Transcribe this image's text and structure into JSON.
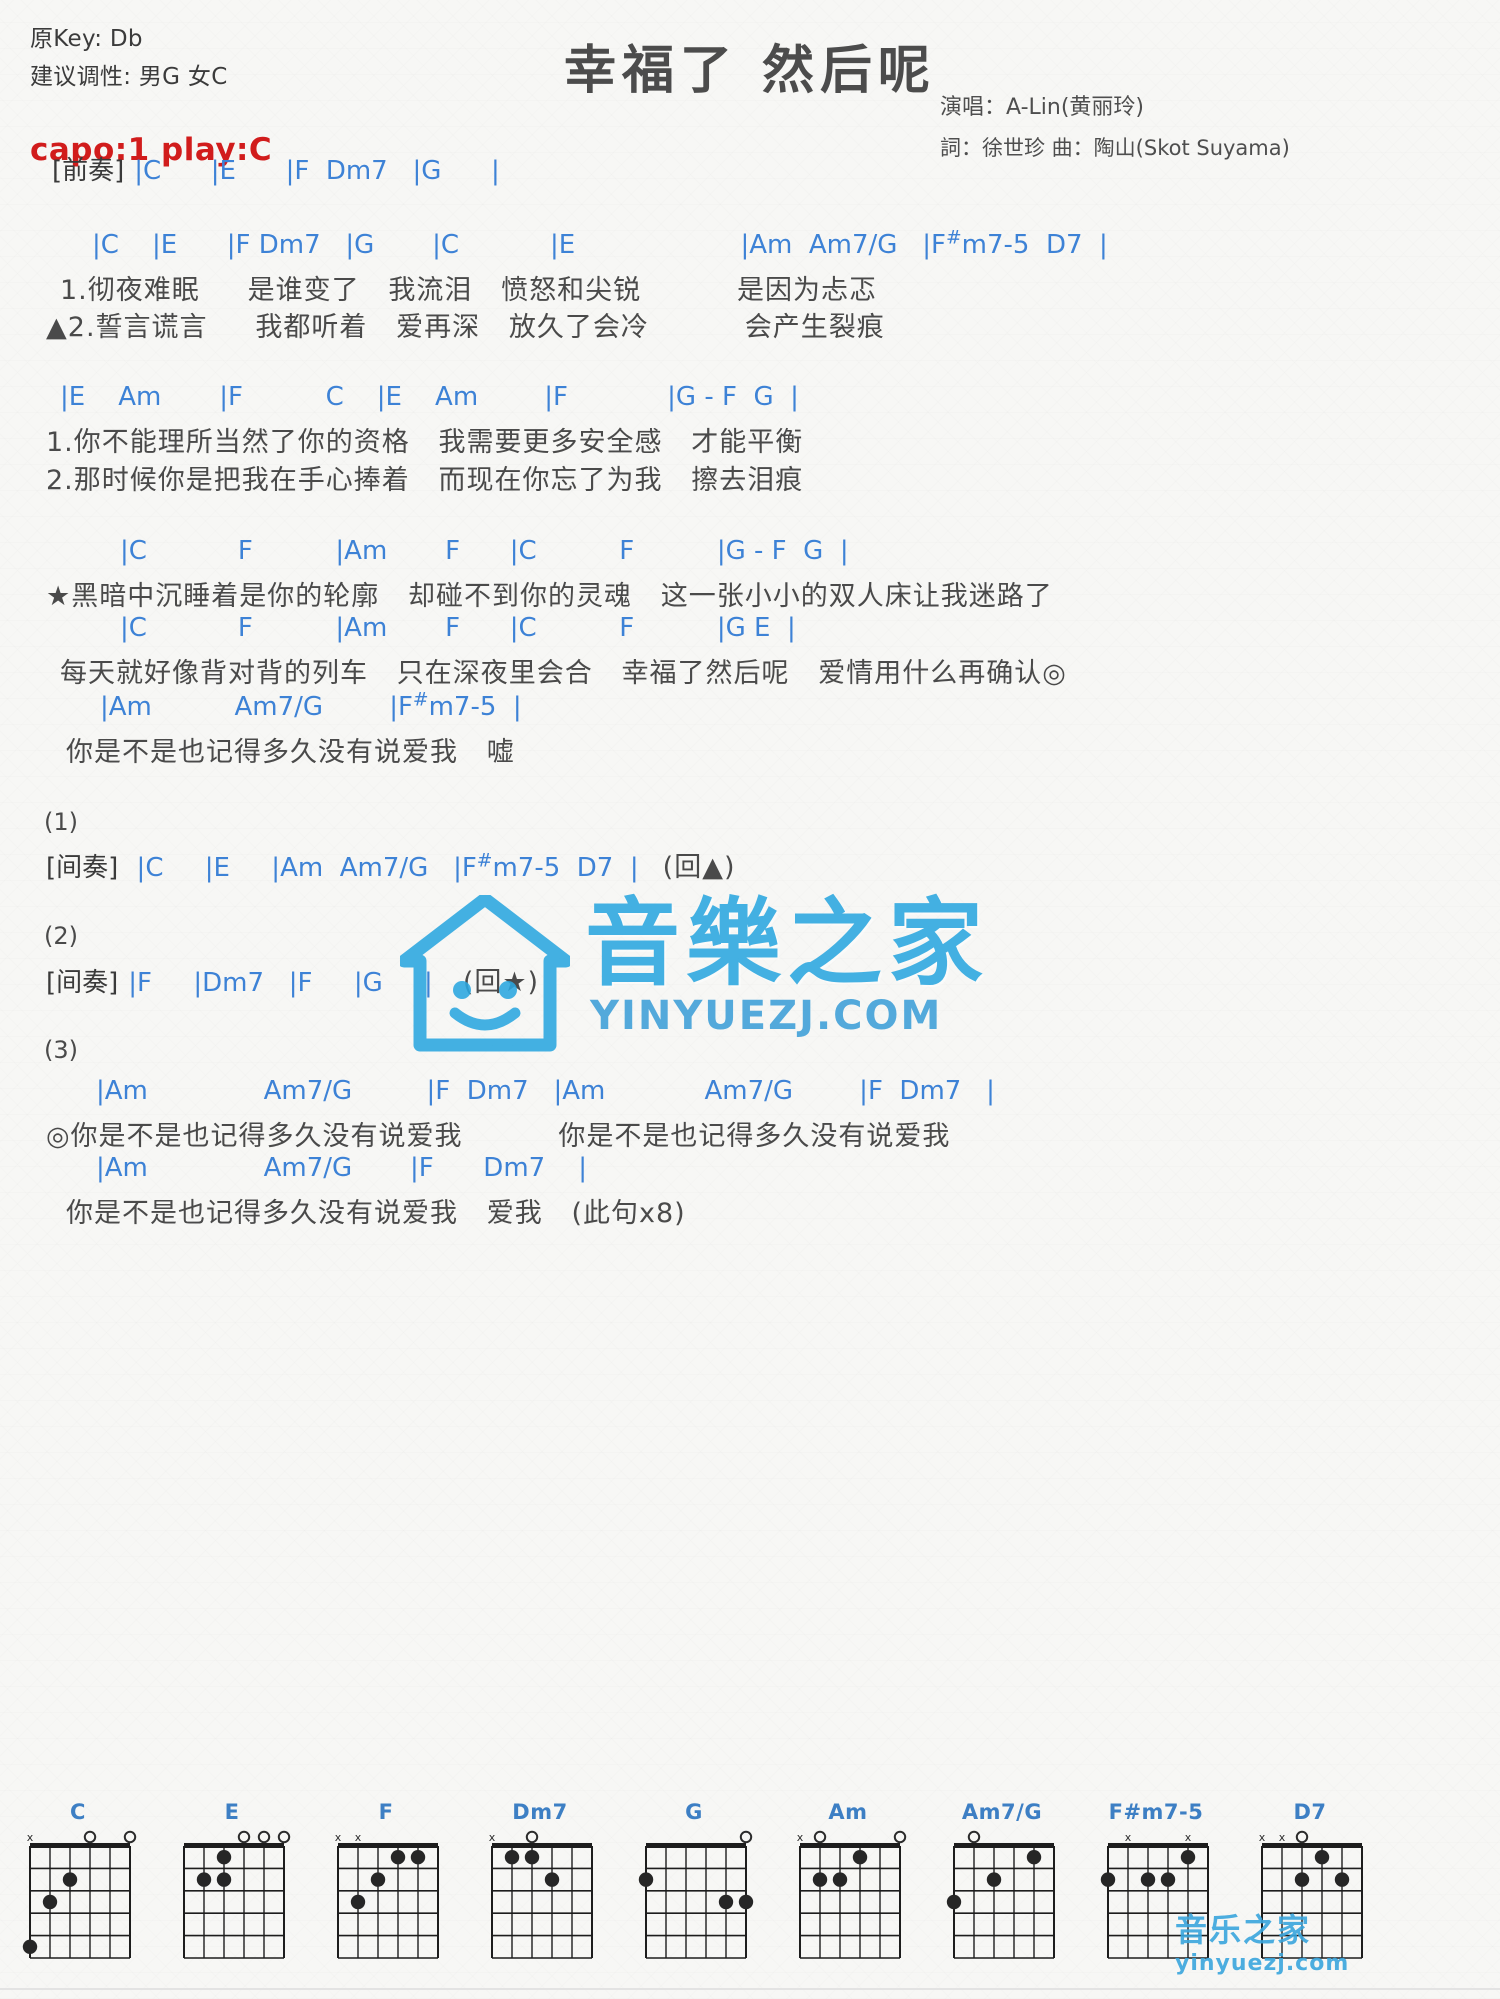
{
  "header": {
    "orig_key": "原Key: Db",
    "suggested_key": "建议调性: 男G 女C",
    "capo": "capo:1 play:C",
    "title": "幸福了 然后呢",
    "singer": "演唱：A-Lin(黄丽玲)",
    "writers": "詞：徐世珍   曲：陶山(Skot Suyama)"
  },
  "colors": {
    "chord": "#3d82d6",
    "capo_red": "#d11c1c",
    "lyric": "#4a4a4a",
    "watermark_blue": "#2ba7e0"
  },
  "sections": [
    {
      "id": "intro",
      "tag": "[前奏]",
      "chords": "|C      |E      |F  Dm7   |G      |"
    },
    {
      "id": "verse1",
      "chords_1": "|C    |E      |F Dm7   |G       |C           |E                    |Am  Am7/G   |F#m7-5  D7  |",
      "lyric_1": "1.彻夜难眠     是谁变了   我流泪   愤怒和尖锐          是因为忐忑",
      "lyric_2": "▲2.誓言谎言     我都听着   爱再深   放久了会冷          会产生裂痕"
    },
    {
      "id": "prechorus",
      "chords": "|E    Am       |F          C    |E    Am        |F            |G - F  G  |",
      "lyric_1": "1.你不能理所当然了你的资格   我需要更多安全感   才能平衡",
      "lyric_2": "2.那时候你是把我在手心捧着   而现在你忘了为我   擦去泪痕"
    },
    {
      "id": "chorus1",
      "chords": "|C           F          |Am       F      |C          F          |G - F  G  |",
      "lyric": "★黑暗中沉睡着是你的轮廓   却碰不到你的灵魂   这一张小小的双人床让我迷路了"
    },
    {
      "id": "chorus2",
      "chords": "|C           F          |Am       F      |C          F          |G E  |",
      "lyric": "每天就好像背对背的列车   只在深夜里会合   幸福了然后呢   爱情用什么再确认◎"
    },
    {
      "id": "chorus3",
      "chords": "|Am          Am7/G        |F#m7-5  |",
      "lyric": "你是不是也记得多久没有说爱我   嘘"
    },
    {
      "id": "interlude1",
      "number": "(1)",
      "tag": "[间奏]",
      "chords": "|C     |E     |Am  Am7/G   |F#m7-5  D7  |",
      "repeat": "(回▲)"
    },
    {
      "id": "interlude2",
      "number": "(2)",
      "tag": "[间奏]",
      "chords": "|F     |Dm7   |F     |G     |",
      "repeat": "(回★)"
    },
    {
      "id": "outro",
      "number": "(3)",
      "chords_1": "|Am              Am7/G         |F  Dm7   |Am            Am7/G        |F  Dm7   |",
      "lyric_1": "◎你是不是也记得多久没有说爱我          你是不是也记得多久没有说爱我",
      "chords_2": "|Am              Am7/G       |F      Dm7    |",
      "lyric_2": "你是不是也记得多久没有说爱我   爱我   (此句x8)"
    }
  ],
  "watermark": {
    "text_cn": "音樂之家",
    "url": "YINYUEZJ.COM",
    "small_cn": "音乐之家",
    "small_url": "yinyuezj.com"
  },
  "chord_diagrams": [
    {
      "name": "C",
      "markers": [
        "x",
        "",
        "",
        "o",
        "",
        "o"
      ],
      "dots": [
        [
          2,
          3
        ],
        [
          3,
          2
        ],
        [
          5,
          1
        ]
      ],
      "barre": null,
      "fret_label": ""
    },
    {
      "name": "E",
      "markers": [
        "",
        "",
        "",
        "o",
        "o",
        "o"
      ],
      "dots": [
        [
          1,
          3
        ],
        [
          2,
          2
        ],
        [
          2,
          3
        ]
      ],
      "barre": null,
      "fret_label": ""
    },
    {
      "name": "F",
      "markers": [
        "x",
        "x",
        "",
        "",
        "",
        ""
      ],
      "dots": [
        [
          3,
          2
        ],
        [
          2,
          3
        ],
        [
          1,
          4
        ],
        [
          1,
          5
        ]
      ],
      "barre": null,
      "fret_label": ""
    },
    {
      "name": "Dm7",
      "markers": [
        "x",
        "",
        "o",
        "",
        "",
        ""
      ],
      "dots": [
        [
          1,
          2
        ],
        [
          1,
          3
        ],
        [
          2,
          4
        ]
      ],
      "barre": "top",
      "fret_label": ""
    },
    {
      "name": "G",
      "markers": [
        "",
        "",
        "",
        "",
        "",
        "o"
      ],
      "dots": [
        [
          2,
          1
        ],
        [
          3,
          5
        ],
        [
          3,
          6
        ]
      ],
      "barre": null,
      "fret_label": ""
    },
    {
      "name": "Am",
      "markers": [
        "x",
        "o",
        "",
        "",
        "",
        "o"
      ],
      "dots": [
        [
          2,
          2
        ],
        [
          2,
          3
        ],
        [
          1,
          4
        ]
      ],
      "barre": null,
      "fret_label": ""
    },
    {
      "name": "Am7/G",
      "markers": [
        "",
        "o",
        "",
        "",
        "",
        ""
      ],
      "dots": [
        [
          3,
          1
        ],
        [
          2,
          3
        ],
        [
          1,
          5
        ]
      ],
      "barre": null,
      "fret_label": ""
    },
    {
      "name": "F#m7-5",
      "markers": [
        "",
        "x",
        "",
        "",
        "x",
        ""
      ],
      "dots": [
        [
          2,
          1
        ],
        [
          2,
          3
        ],
        [
          2,
          4
        ],
        [
          1,
          5
        ]
      ],
      "barre": null,
      "fret_label": ""
    },
    {
      "name": "D7",
      "markers": [
        "x",
        "x",
        "o",
        "",
        "",
        ""
      ],
      "dots": [
        [
          2,
          3
        ],
        [
          1,
          4
        ],
        [
          2,
          5
        ]
      ],
      "barre": null,
      "fret_label": ""
    }
  ]
}
